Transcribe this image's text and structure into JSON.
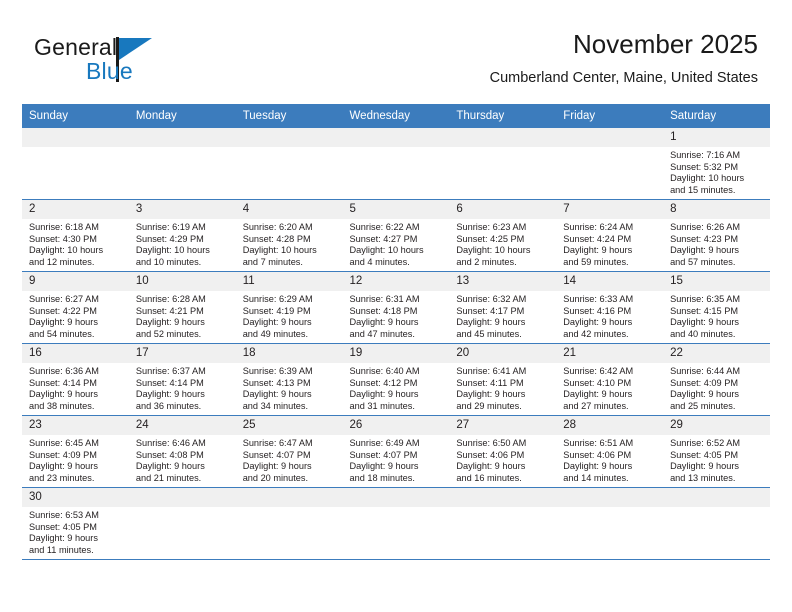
{
  "brand": {
    "name_top": "General",
    "name_bottom": "Blue",
    "accent_color": "#1878be",
    "logo_icon": "general-blue-triangle-logo"
  },
  "header": {
    "title": "November 2025",
    "subtitle": "Cumberland Center, Maine, United States"
  },
  "calendar": {
    "header_color": "#3c7cbd",
    "daynum_bg": "#f0f0f0",
    "weekdays": [
      "Sunday",
      "Monday",
      "Tuesday",
      "Wednesday",
      "Thursday",
      "Friday",
      "Saturday"
    ],
    "weeks": [
      [
        {
          "day": "",
          "lines": []
        },
        {
          "day": "",
          "lines": []
        },
        {
          "day": "",
          "lines": []
        },
        {
          "day": "",
          "lines": []
        },
        {
          "day": "",
          "lines": []
        },
        {
          "day": "",
          "lines": []
        },
        {
          "day": "1",
          "lines": [
            "Sunrise: 7:16 AM",
            "Sunset: 5:32 PM",
            "Daylight: 10 hours",
            "and 15 minutes."
          ]
        }
      ],
      [
        {
          "day": "2",
          "lines": [
            "Sunrise: 6:18 AM",
            "Sunset: 4:30 PM",
            "Daylight: 10 hours",
            "and 12 minutes."
          ]
        },
        {
          "day": "3",
          "lines": [
            "Sunrise: 6:19 AM",
            "Sunset: 4:29 PM",
            "Daylight: 10 hours",
            "and 10 minutes."
          ]
        },
        {
          "day": "4",
          "lines": [
            "Sunrise: 6:20 AM",
            "Sunset: 4:28 PM",
            "Daylight: 10 hours",
            "and 7 minutes."
          ]
        },
        {
          "day": "5",
          "lines": [
            "Sunrise: 6:22 AM",
            "Sunset: 4:27 PM",
            "Daylight: 10 hours",
            "and 4 minutes."
          ]
        },
        {
          "day": "6",
          "lines": [
            "Sunrise: 6:23 AM",
            "Sunset: 4:25 PM",
            "Daylight: 10 hours",
            "and 2 minutes."
          ]
        },
        {
          "day": "7",
          "lines": [
            "Sunrise: 6:24 AM",
            "Sunset: 4:24 PM",
            "Daylight: 9 hours",
            "and 59 minutes."
          ]
        },
        {
          "day": "8",
          "lines": [
            "Sunrise: 6:26 AM",
            "Sunset: 4:23 PM",
            "Daylight: 9 hours",
            "and 57 minutes."
          ]
        }
      ],
      [
        {
          "day": "9",
          "lines": [
            "Sunrise: 6:27 AM",
            "Sunset: 4:22 PM",
            "Daylight: 9 hours",
            "and 54 minutes."
          ]
        },
        {
          "day": "10",
          "lines": [
            "Sunrise: 6:28 AM",
            "Sunset: 4:21 PM",
            "Daylight: 9 hours",
            "and 52 minutes."
          ]
        },
        {
          "day": "11",
          "lines": [
            "Sunrise: 6:29 AM",
            "Sunset: 4:19 PM",
            "Daylight: 9 hours",
            "and 49 minutes."
          ]
        },
        {
          "day": "12",
          "lines": [
            "Sunrise: 6:31 AM",
            "Sunset: 4:18 PM",
            "Daylight: 9 hours",
            "and 47 minutes."
          ]
        },
        {
          "day": "13",
          "lines": [
            "Sunrise: 6:32 AM",
            "Sunset: 4:17 PM",
            "Daylight: 9 hours",
            "and 45 minutes."
          ]
        },
        {
          "day": "14",
          "lines": [
            "Sunrise: 6:33 AM",
            "Sunset: 4:16 PM",
            "Daylight: 9 hours",
            "and 42 minutes."
          ]
        },
        {
          "day": "15",
          "lines": [
            "Sunrise: 6:35 AM",
            "Sunset: 4:15 PM",
            "Daylight: 9 hours",
            "and 40 minutes."
          ]
        }
      ],
      [
        {
          "day": "16",
          "lines": [
            "Sunrise: 6:36 AM",
            "Sunset: 4:14 PM",
            "Daylight: 9 hours",
            "and 38 minutes."
          ]
        },
        {
          "day": "17",
          "lines": [
            "Sunrise: 6:37 AM",
            "Sunset: 4:14 PM",
            "Daylight: 9 hours",
            "and 36 minutes."
          ]
        },
        {
          "day": "18",
          "lines": [
            "Sunrise: 6:39 AM",
            "Sunset: 4:13 PM",
            "Daylight: 9 hours",
            "and 34 minutes."
          ]
        },
        {
          "day": "19",
          "lines": [
            "Sunrise: 6:40 AM",
            "Sunset: 4:12 PM",
            "Daylight: 9 hours",
            "and 31 minutes."
          ]
        },
        {
          "day": "20",
          "lines": [
            "Sunrise: 6:41 AM",
            "Sunset: 4:11 PM",
            "Daylight: 9 hours",
            "and 29 minutes."
          ]
        },
        {
          "day": "21",
          "lines": [
            "Sunrise: 6:42 AM",
            "Sunset: 4:10 PM",
            "Daylight: 9 hours",
            "and 27 minutes."
          ]
        },
        {
          "day": "22",
          "lines": [
            "Sunrise: 6:44 AM",
            "Sunset: 4:09 PM",
            "Daylight: 9 hours",
            "and 25 minutes."
          ]
        }
      ],
      [
        {
          "day": "23",
          "lines": [
            "Sunrise: 6:45 AM",
            "Sunset: 4:09 PM",
            "Daylight: 9 hours",
            "and 23 minutes."
          ]
        },
        {
          "day": "24",
          "lines": [
            "Sunrise: 6:46 AM",
            "Sunset: 4:08 PM",
            "Daylight: 9 hours",
            "and 21 minutes."
          ]
        },
        {
          "day": "25",
          "lines": [
            "Sunrise: 6:47 AM",
            "Sunset: 4:07 PM",
            "Daylight: 9 hours",
            "and 20 minutes."
          ]
        },
        {
          "day": "26",
          "lines": [
            "Sunrise: 6:49 AM",
            "Sunset: 4:07 PM",
            "Daylight: 9 hours",
            "and 18 minutes."
          ]
        },
        {
          "day": "27",
          "lines": [
            "Sunrise: 6:50 AM",
            "Sunset: 4:06 PM",
            "Daylight: 9 hours",
            "and 16 minutes."
          ]
        },
        {
          "day": "28",
          "lines": [
            "Sunrise: 6:51 AM",
            "Sunset: 4:06 PM",
            "Daylight: 9 hours",
            "and 14 minutes."
          ]
        },
        {
          "day": "29",
          "lines": [
            "Sunrise: 6:52 AM",
            "Sunset: 4:05 PM",
            "Daylight: 9 hours",
            "and 13 minutes."
          ]
        }
      ],
      [
        {
          "day": "30",
          "lines": [
            "Sunrise: 6:53 AM",
            "Sunset: 4:05 PM",
            "Daylight: 9 hours",
            "and 11 minutes."
          ]
        },
        {
          "day": "",
          "lines": []
        },
        {
          "day": "",
          "lines": []
        },
        {
          "day": "",
          "lines": []
        },
        {
          "day": "",
          "lines": []
        },
        {
          "day": "",
          "lines": []
        },
        {
          "day": "",
          "lines": []
        }
      ]
    ]
  }
}
